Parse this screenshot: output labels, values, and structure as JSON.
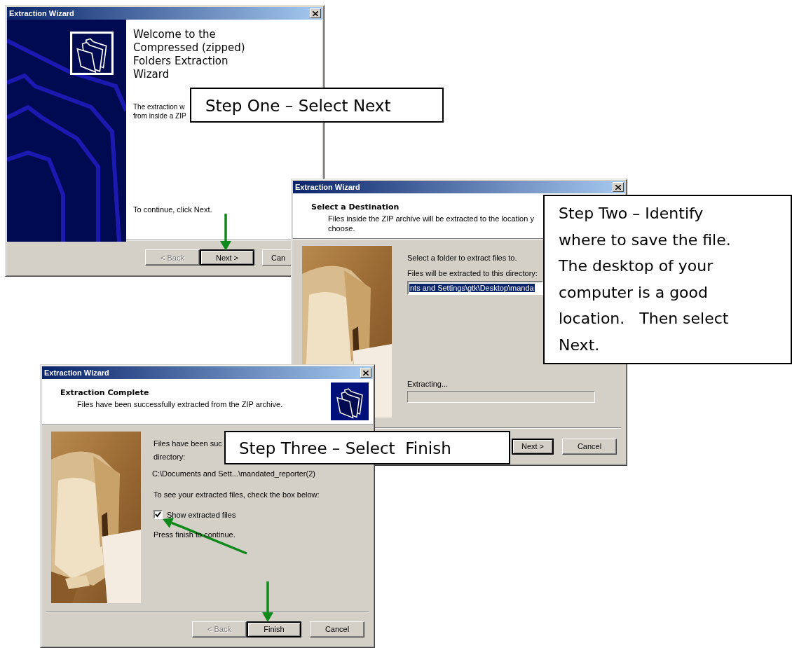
{
  "windows": [
    {
      "kind": "welcome",
      "title": "Extraction Wizard",
      "heading": "Welcome to the\nCompressed (zipped)\nFolders Extraction\nWizard",
      "intro": "The extraction w\nfrom inside a ZIP",
      "continue_text": "To continue, click Next.",
      "buttons": [
        {
          "label": "< Back",
          "disabled": true,
          "default": false
        },
        {
          "label": "Next >",
          "disabled": false,
          "default": true
        },
        {
          "label": "Can",
          "disabled": false,
          "default": false
        }
      ]
    },
    {
      "kind": "destination",
      "title": "Extraction Wizard",
      "heading": "Select a Destination",
      "subheading": "Files inside the ZIP archive will be extracted to the location y\nchoose.",
      "prompt": "Select a folder to extract files to.",
      "field_label": "Files will be extracted to this directory:",
      "field": {
        "value": "nts and Settings\\gtk\\Desktop\\manda",
        "selected": true
      },
      "progress_label": "Extracting...",
      "progress": {
        "level": 0
      },
      "buttons": [
        {
          "label": "Next >",
          "disabled": false,
          "default": true
        },
        {
          "label": "Cancel",
          "disabled": false,
          "default": false
        }
      ]
    },
    {
      "kind": "complete",
      "title": "Extraction Wizard",
      "heading": "Extraction Complete",
      "subheading": "Files have been successfully extracted from the ZIP archive.",
      "result_text": "Files have been suc\ndirectory:",
      "path": "C:\\Documents and Sett...\\mandated_reporter(2)",
      "checkbox_hint": "To see your extracted files, check the box below:",
      "checkbox": {
        "label": "Show extracted files",
        "checked": true
      },
      "finish_hint": "Press finish to continue.",
      "buttons": [
        {
          "label": "< Back",
          "disabled": true,
          "default": false
        },
        {
          "label": "Finish",
          "disabled": false,
          "default": true
        },
        {
          "label": "Cancel",
          "disabled": false,
          "default": false
        }
      ]
    }
  ],
  "callouts": [
    {
      "text": "Step One – Select Next"
    },
    {
      "text": "Step Two – Identify\nwhere to save the file.\nThe desktop of your\ncomputer is a good\nlocation.   Then select\nNext."
    },
    {
      "text": "Step Three – Select  Finish"
    }
  ]
}
